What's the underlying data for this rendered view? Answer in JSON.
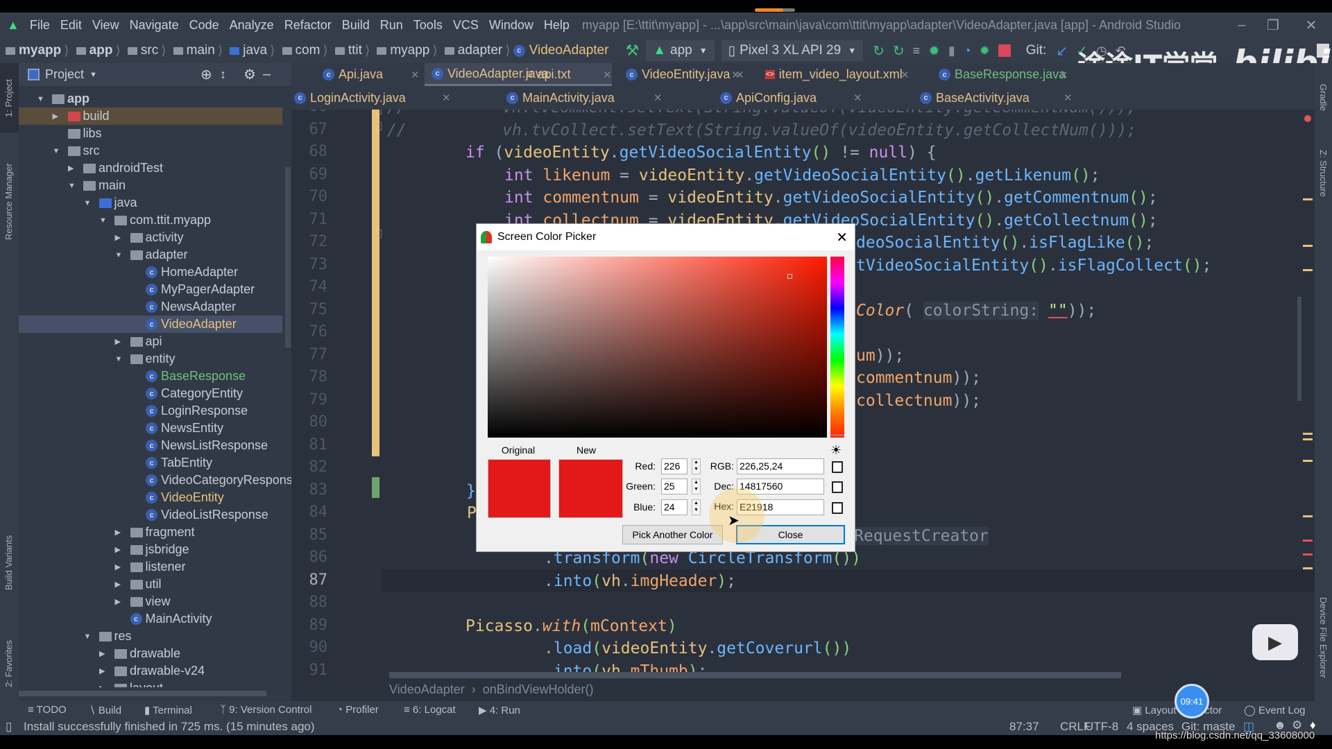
{
  "menu": {
    "items": [
      "File",
      "Edit",
      "View",
      "Navigate",
      "Code",
      "Analyze",
      "Refactor",
      "Build",
      "Run",
      "Tools",
      "VCS",
      "Window",
      "Help"
    ],
    "window_title": "myapp [E:\\ttit\\myapp] - ...\\app\\src\\main\\java\\com\\ttit\\myapp\\adapter\\VideoAdapter.java [app] - Android Studio"
  },
  "breadcrumb": [
    "myapp",
    "app",
    "src",
    "main",
    "java",
    "com",
    "ttit",
    "myapp",
    "adapter",
    "VideoAdapter"
  ],
  "toolbar": {
    "run_config": "app",
    "device": "Pixel 3 XL API 29",
    "git_label": "Git:"
  },
  "watermark": {
    "channel": "途途IT学堂",
    "site": "bilibili",
    "url": "https://blog.csdn.net/qq_33608000"
  },
  "left_strip": {
    "project": "1: Project",
    "resource_manager": "Resource Manager",
    "build_variants": "Build Variants",
    "favorites": "2: Favorites"
  },
  "right_strip": {
    "gradle": "Gradle",
    "structure": "Z: Structure",
    "device_file_explorer": "Device File Explorer"
  },
  "project_panel": {
    "title": "Project",
    "tree": [
      {
        "label": "app",
        "level": 0,
        "kind": "module",
        "state": "open"
      },
      {
        "label": "build",
        "level": 1,
        "kind": "excluded",
        "state": "closed"
      },
      {
        "label": "libs",
        "level": 1,
        "kind": "folder",
        "state": "leaf"
      },
      {
        "label": "src",
        "level": 1,
        "kind": "folder",
        "state": "open"
      },
      {
        "label": "androidTest",
        "level": 2,
        "kind": "folder",
        "state": "closed"
      },
      {
        "label": "main",
        "level": 2,
        "kind": "folder",
        "state": "open"
      },
      {
        "label": "java",
        "level": 3,
        "kind": "source",
        "state": "open"
      },
      {
        "label": "com.ttit.myapp",
        "level": 4,
        "kind": "package",
        "state": "open"
      },
      {
        "label": "activity",
        "level": 5,
        "kind": "package",
        "state": "closed"
      },
      {
        "label": "adapter",
        "level": 5,
        "kind": "package",
        "state": "open"
      },
      {
        "label": "HomeAdapter",
        "level": 6,
        "kind": "class",
        "state": "leaf"
      },
      {
        "label": "MyPagerAdapter",
        "level": 6,
        "kind": "class",
        "state": "leaf"
      },
      {
        "label": "NewsAdapter",
        "level": 6,
        "kind": "class",
        "state": "leaf"
      },
      {
        "label": "VideoAdapter",
        "level": 6,
        "kind": "class",
        "state": "leaf",
        "selected": true,
        "vcs": "modified"
      },
      {
        "label": "api",
        "level": 5,
        "kind": "package",
        "state": "closed"
      },
      {
        "label": "entity",
        "level": 5,
        "kind": "package",
        "state": "open"
      },
      {
        "label": "BaseResponse",
        "level": 6,
        "kind": "class",
        "state": "leaf",
        "vcs": "added"
      },
      {
        "label": "CategoryEntity",
        "level": 6,
        "kind": "class",
        "state": "leaf"
      },
      {
        "label": "LoginResponse",
        "level": 6,
        "kind": "class",
        "state": "leaf"
      },
      {
        "label": "NewsEntity",
        "level": 6,
        "kind": "class",
        "state": "leaf"
      },
      {
        "label": "NewsListResponse",
        "level": 6,
        "kind": "class",
        "state": "leaf"
      },
      {
        "label": "TabEntity",
        "level": 6,
        "kind": "class",
        "state": "leaf"
      },
      {
        "label": "VideoCategoryResponse",
        "level": 6,
        "kind": "class",
        "state": "leaf"
      },
      {
        "label": "VideoEntity",
        "level": 6,
        "kind": "class",
        "state": "leaf",
        "vcs": "modified"
      },
      {
        "label": "VideoListResponse",
        "level": 6,
        "kind": "class",
        "state": "leaf"
      },
      {
        "label": "fragment",
        "level": 5,
        "kind": "package",
        "state": "closed"
      },
      {
        "label": "jsbridge",
        "level": 5,
        "kind": "package",
        "state": "closed"
      },
      {
        "label": "listener",
        "level": 5,
        "kind": "package",
        "state": "closed"
      },
      {
        "label": "util",
        "level": 5,
        "kind": "package",
        "state": "closed"
      },
      {
        "label": "view",
        "level": 5,
        "kind": "package",
        "state": "closed"
      },
      {
        "label": "MainActivity",
        "level": 5,
        "kind": "class",
        "state": "leaf"
      },
      {
        "label": "res",
        "level": 3,
        "kind": "res",
        "state": "open"
      },
      {
        "label": "drawable",
        "level": 4,
        "kind": "folder",
        "state": "closed"
      },
      {
        "label": "drawable-v24",
        "level": 4,
        "kind": "folder",
        "state": "closed"
      },
      {
        "label": "layout",
        "level": 4,
        "kind": "folder",
        "state": "closed"
      }
    ]
  },
  "tabs_row1": [
    {
      "label": "Api.java",
      "icon": "class"
    },
    {
      "label": "VideoAdapter.java",
      "icon": "class",
      "active": true
    },
    {
      "label": "api.txt",
      "icon": "text"
    },
    {
      "label": "VideoEntity.java",
      "icon": "class"
    },
    {
      "label": "item_video_layout.xml",
      "icon": "xml"
    },
    {
      "label": "BaseResponse.java",
      "icon": "class"
    }
  ],
  "tabs_row2": [
    {
      "label": "LoginActivity.java",
      "icon": "class"
    },
    {
      "label": "MainActivity.java",
      "icon": "class"
    },
    {
      "label": "ApiConfig.java",
      "icon": "class"
    },
    {
      "label": "BaseActivity.java",
      "icon": "class"
    }
  ],
  "editor": {
    "current_line": "87",
    "lines": [
      {
        "num": "66",
        "tokens": [
          [
            "//          vh.tvComment.setText(String.valueOf(videoEntity.getCommentNum()));",
            "c"
          ]
        ]
      },
      {
        "num": "67",
        "tokens": [
          [
            "//          vh.tvCollect.setText(String.valueOf(videoEntity.getCollectNum()));",
            "c"
          ]
        ]
      },
      {
        "num": "68",
        "tokens": [
          [
            "if ",
            "kw"
          ],
          [
            "(",
            "p"
          ],
          [
            "videoEntity",
            "fld"
          ],
          [
            ".",
            "p"
          ],
          [
            "getVideoSocialEntity",
            "fn"
          ],
          [
            "()",
            "par"
          ],
          [
            " != ",
            "p"
          ],
          [
            "null",
            "kw"
          ],
          [
            ") {",
            "p"
          ]
        ]
      },
      {
        "num": "69",
        "tokens": [
          [
            "int ",
            "kw"
          ],
          [
            "likenum",
            "loc"
          ],
          [
            " = ",
            "p"
          ],
          [
            "videoEntity",
            "fld"
          ],
          [
            ".",
            "p"
          ],
          [
            "getVideoSocialEntity",
            "fn"
          ],
          [
            "()",
            "par"
          ],
          [
            ".",
            "p"
          ],
          [
            "getLikenum",
            "fn"
          ],
          [
            "()",
            "par"
          ],
          [
            ";",
            "p"
          ]
        ]
      },
      {
        "num": "70",
        "tokens": [
          [
            "int ",
            "kw"
          ],
          [
            "commentnum",
            "loc"
          ],
          [
            " = ",
            "p"
          ],
          [
            "videoEntity",
            "fld"
          ],
          [
            ".",
            "p"
          ],
          [
            "getVideoSocialEntity",
            "fn"
          ],
          [
            "()",
            "par"
          ],
          [
            ".",
            "p"
          ],
          [
            "getCommentnum",
            "fn"
          ],
          [
            "()",
            "par"
          ],
          [
            ";",
            "p"
          ]
        ]
      },
      {
        "num": "71",
        "tokens": [
          [
            "int ",
            "kw"
          ],
          [
            "collectnum",
            "loc"
          ],
          [
            " = ",
            "p"
          ],
          [
            "videoEntity",
            "fld"
          ],
          [
            ".",
            "p"
          ],
          [
            "getVideoSocialEntity",
            "fn"
          ],
          [
            "()",
            "par"
          ],
          [
            ".",
            "p"
          ],
          [
            "getCollectnum",
            "fn"
          ],
          [
            "()",
            "par"
          ],
          [
            ";",
            "p"
          ]
        ]
      },
      {
        "num": "72",
        "tokens": [
          [
            "deoSocialEntity",
            "fn"
          ],
          [
            "()",
            "par"
          ],
          [
            ".",
            "p"
          ],
          [
            "isFlagLike",
            "fn"
          ],
          [
            "()",
            "par"
          ],
          [
            ";",
            "p"
          ]
        ]
      },
      {
        "num": "73",
        "tokens": [
          [
            "tVideoSocialEntity",
            "fn"
          ],
          [
            "()",
            "par"
          ],
          [
            ".",
            "p"
          ],
          [
            "isFlagCollect",
            "fn"
          ],
          [
            "()",
            "par"
          ],
          [
            ";",
            "p"
          ]
        ]
      },
      {
        "num": "74",
        "tokens": []
      },
      {
        "num": "75",
        "tokens": [
          [
            "Color",
            "it"
          ],
          [
            "( ",
            "p"
          ],
          [
            "colorString:",
            "hint"
          ],
          [
            " ",
            "p"
          ],
          [
            "\"\"",
            "str"
          ],
          [
            "));",
            "p"
          ]
        ]
      },
      {
        "num": "76",
        "tokens": []
      },
      {
        "num": "77",
        "tokens": [
          [
            "um",
            "loc"
          ],
          [
            "));",
            "p"
          ]
        ]
      },
      {
        "num": "78",
        "tokens": [
          [
            "commentnum",
            "loc"
          ],
          [
            "));",
            "p"
          ]
        ]
      },
      {
        "num": "79",
        "tokens": [
          [
            "collectnum",
            "loc"
          ],
          [
            "));",
            "p"
          ]
        ]
      },
      {
        "num": "80",
        "tokens": []
      },
      {
        "num": "81",
        "tokens": []
      },
      {
        "num": "82",
        "tokens": []
      },
      {
        "num": "83",
        "tokens": [
          [
            "}",
            "fn"
          ]
        ]
      },
      {
        "num": "84",
        "tokens": [
          [
            "P",
            "fld"
          ]
        ]
      },
      {
        "num": "85",
        "tokens": [
          [
            "RequestCreator",
            "hint"
          ]
        ]
      },
      {
        "num": "86",
        "tokens": [
          [
            ".",
            "p"
          ],
          [
            "transform",
            "fn"
          ],
          [
            "(",
            "par"
          ],
          [
            "new ",
            "kw"
          ],
          [
            "CircleTransform",
            "fn"
          ],
          [
            "())",
            "par"
          ]
        ]
      },
      {
        "num": "87",
        "tokens": [
          [
            ".",
            "p"
          ],
          [
            "into",
            "fn"
          ],
          [
            "(",
            "par"
          ],
          [
            "vh",
            "fld"
          ],
          [
            ".",
            "p"
          ],
          [
            "imgHeader",
            "loc"
          ],
          [
            ")",
            "par"
          ],
          [
            ";",
            "p"
          ]
        ]
      },
      {
        "num": "88",
        "tokens": []
      },
      {
        "num": "89",
        "tokens": [
          [
            "Picasso",
            "fld"
          ],
          [
            ".",
            "p"
          ],
          [
            "with",
            "it"
          ],
          [
            "(",
            "par"
          ],
          [
            "mContext",
            "loc"
          ],
          [
            ")",
            "par"
          ]
        ]
      },
      {
        "num": "90",
        "tokens": [
          [
            ".",
            "p"
          ],
          [
            "load",
            "fn"
          ],
          [
            "(",
            "par"
          ],
          [
            "videoEntity",
            "fld"
          ],
          [
            ".",
            "p"
          ],
          [
            "getCoverurl",
            "fn"
          ],
          [
            "())",
            "par"
          ]
        ]
      },
      {
        "num": "91",
        "tokens": [
          [
            ".",
            "p"
          ],
          [
            "into",
            "fn"
          ],
          [
            "(",
            "par"
          ],
          [
            "vh",
            "fld"
          ],
          [
            ".",
            "p"
          ],
          [
            "mThumb",
            "loc"
          ],
          [
            ")",
            "par"
          ],
          [
            ";",
            "p"
          ]
        ]
      }
    ],
    "breadcrumb": [
      "VideoAdapter",
      "onBindViewHolder()"
    ]
  },
  "color_picker": {
    "title": "Screen Color Picker",
    "original_label": "Original",
    "new_label": "New",
    "original_color": "#E21918",
    "new_color": "#E21918",
    "red_label": "Red:",
    "red": "226",
    "green_label": "Green:",
    "green": "25",
    "blue_label": "Blue:",
    "blue": "24",
    "rgb_label": "RGB:",
    "rgb": "226,25,24",
    "dec_label": "Dec:",
    "dec": "14817560",
    "hex_label": "Hex:",
    "hex": "E21918",
    "pick_button": "Pick Another Color",
    "close_button": "Close"
  },
  "tool_windows": {
    "left": [
      "TODO",
      "Build",
      "Terminal",
      "9: Version Control",
      "Profiler",
      "6: Logcat",
      "4: Run"
    ],
    "right": [
      "Layout Inspector",
      "Event Log"
    ]
  },
  "overlay": {
    "clock": "09:41"
  },
  "status_bar": {
    "message": "Install successfully finished in 725 ms. (15 minutes ago)",
    "position": "87:37",
    "line_sep": "CRLF",
    "encoding": "UTF-8",
    "indent": "4 spaces",
    "git": "Git: maste"
  }
}
